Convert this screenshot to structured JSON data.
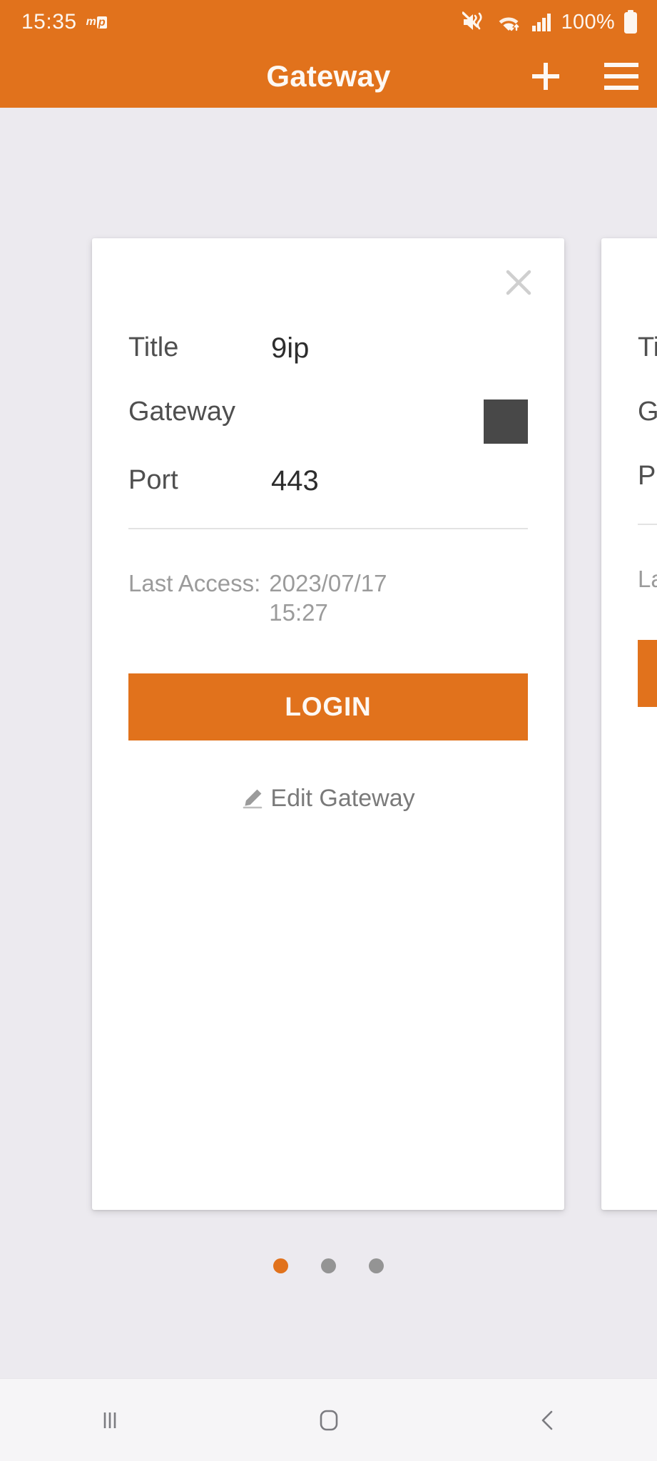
{
  "status_bar": {
    "time": "15:35",
    "badge_m": "m",
    "badge_p": "p",
    "battery_percent": "100%",
    "icons": [
      "mute-vibrate-icon",
      "wifi-icon",
      "signal-icon",
      "battery-icon"
    ]
  },
  "app_bar": {
    "title": "Gateway",
    "add_label": "+",
    "menu_label": "menu"
  },
  "cards": [
    {
      "close_label": "×",
      "rows": [
        {
          "label": "Title",
          "value": "9ip",
          "redacted": false
        },
        {
          "label": "Gateway",
          "value": "",
          "redacted": true
        },
        {
          "label": "Port",
          "value": "443",
          "redacted": false
        }
      ],
      "last_access_label": "Last Access:",
      "last_access_value": "2023/07/17 15:27",
      "login_label": "LOGIN",
      "edit_label": "Edit Gateway"
    },
    {
      "close_label": "×",
      "rows": [
        {
          "label": "Title",
          "value": "",
          "redacted": false
        },
        {
          "label": "Gateway",
          "value": "",
          "redacted": false
        },
        {
          "label": "Port",
          "value": "",
          "redacted": false
        }
      ],
      "last_access_label": "Last Access:",
      "last_access_value": "",
      "login_label": "",
      "edit_label": ""
    }
  ],
  "pagination": {
    "total": 3,
    "active_index": 0
  },
  "nav_bar": {
    "recents_label": "recents",
    "home_label": "home",
    "back_label": "back"
  },
  "colors": {
    "accent": "#e1721c",
    "background": "#eceaef",
    "card": "#ffffff",
    "redaction": "#484848",
    "muted_text": "#9b9b9b"
  }
}
